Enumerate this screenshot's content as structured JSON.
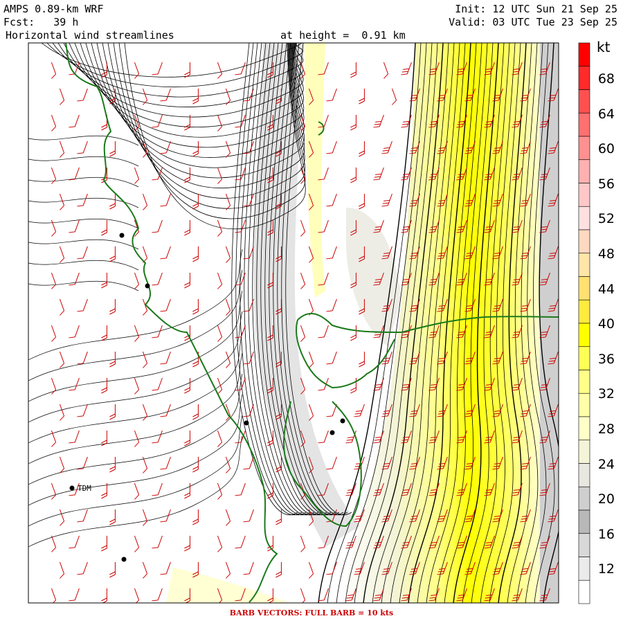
{
  "header": {
    "model": "AMPS 0.89-km WRF",
    "forecast": "Fcst:   39 h",
    "product": "Horizontal wind streamlines",
    "height": "at height =  0.91 km",
    "init": "Init: 12 UTC Sun 21 Sep 25",
    "valid": "Valid: 03 UTC Tue 23 Sep 25"
  },
  "colorbar": {
    "unit": "kt",
    "labels": [
      "68",
      "64",
      "60",
      "56",
      "52",
      "48",
      "44",
      "40",
      "36",
      "32",
      "28",
      "24",
      "20",
      "16",
      "12"
    ],
    "colors": [
      "#ff0000",
      "#ff2a2a",
      "#ff5050",
      "#ff7070",
      "#ff9090",
      "#ffb0b0",
      "#ffc8c8",
      "#ffe0e0",
      "#ffd8c0",
      "#ffe6a8",
      "#ffe070",
      "#ffea40",
      "#ffff00",
      "#ffff55",
      "#ffff88",
      "#ffffaa",
      "#ffffc8",
      "#f4f4d8",
      "#e8e8e0",
      "#cfcfcf",
      "#b8b8b8",
      "#d8d8d8",
      "#ebebeb",
      "#ffffff"
    ]
  },
  "station_label": "TDM",
  "footer": "BARB VECTORS:  FULL BARB = 10 kts",
  "colors": {
    "coast": "#1a7a1a",
    "barb": "#cc0000",
    "streamline": "#000000"
  }
}
